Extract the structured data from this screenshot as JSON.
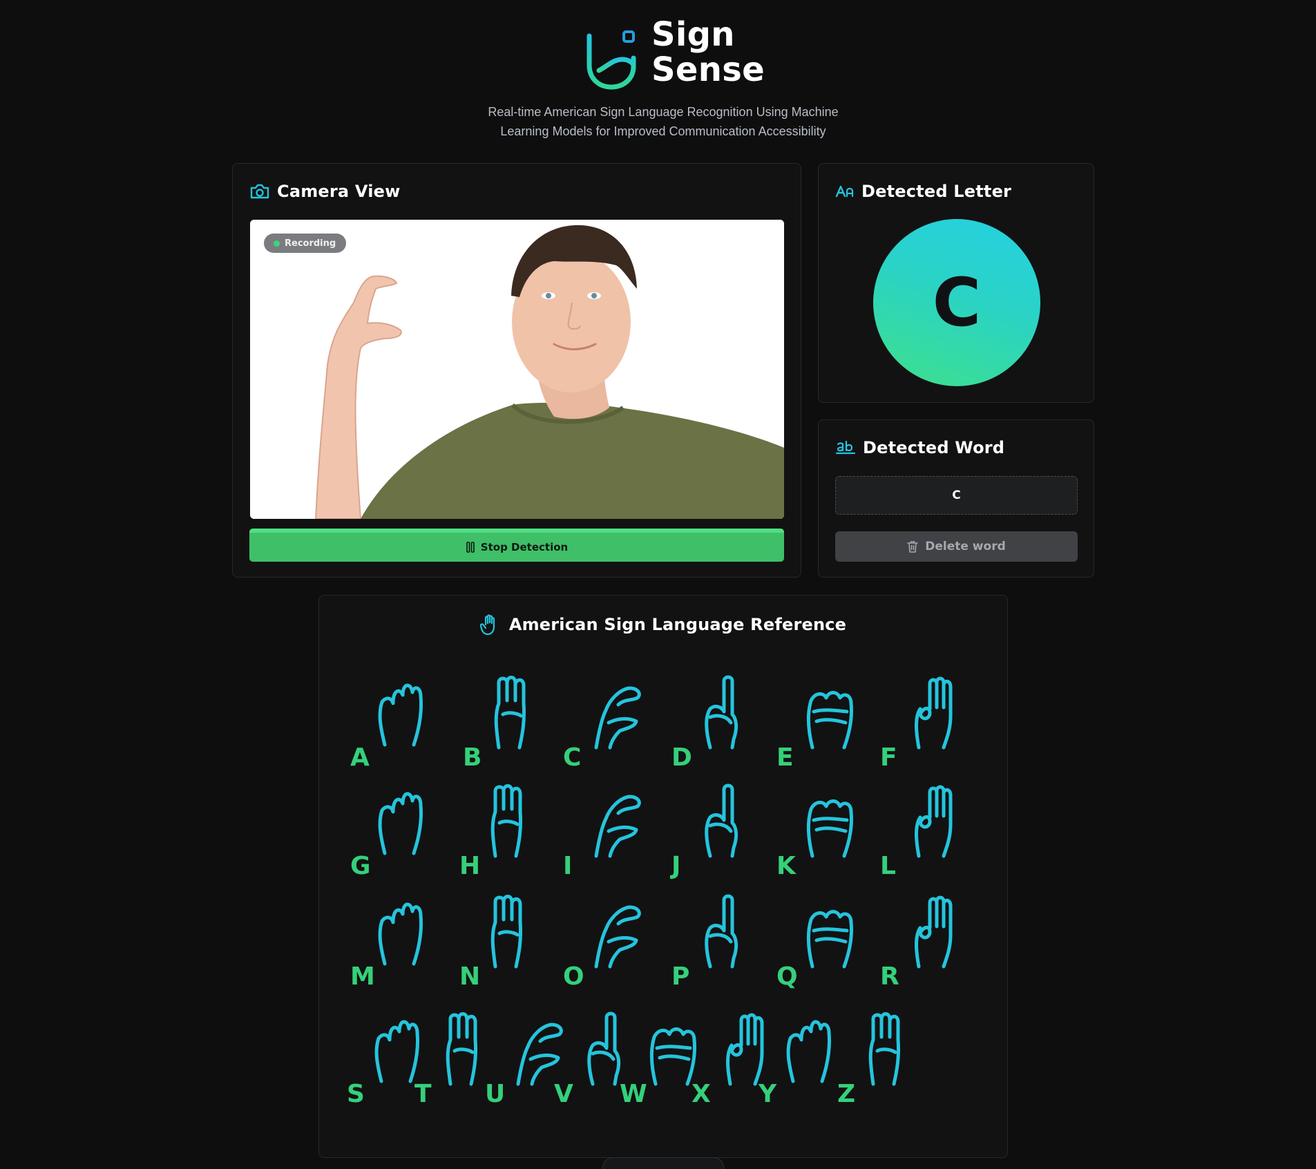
{
  "brand": {
    "name_line1": "Sign",
    "name_line2": "Sense",
    "logo_icon": "hand-logo-icon"
  },
  "tagline": {
    "line1": "Real-time American Sign Language Recognition Using Machine",
    "line2": "Learning Models for Improved Communication Accessibility"
  },
  "camera": {
    "title": "Camera View",
    "icon": "camera-icon",
    "status": "Recording",
    "stop_label": "Stop Detection"
  },
  "letter": {
    "title": "Detected Letter",
    "icon": "letter-case-icon",
    "value": "C"
  },
  "word": {
    "title": "Detected Word",
    "icon": "text-ab-icon",
    "value": "C",
    "delete_label": "Delete word"
  },
  "reference": {
    "title": "American Sign Language Reference",
    "icon": "hand-icon",
    "letters": [
      "A",
      "B",
      "C",
      "D",
      "E",
      "F",
      "G",
      "H",
      "I",
      "J",
      "K",
      "L",
      "M",
      "N",
      "O",
      "P",
      "Q",
      "R",
      "S",
      "T",
      "U",
      "V",
      "W",
      "X",
      "Y",
      "Z"
    ]
  },
  "colors": {
    "accent_cyan": "#25c4dc",
    "accent_green": "#3fbf68",
    "letter_green": "#35d07a",
    "background": "#0e0e0f"
  }
}
